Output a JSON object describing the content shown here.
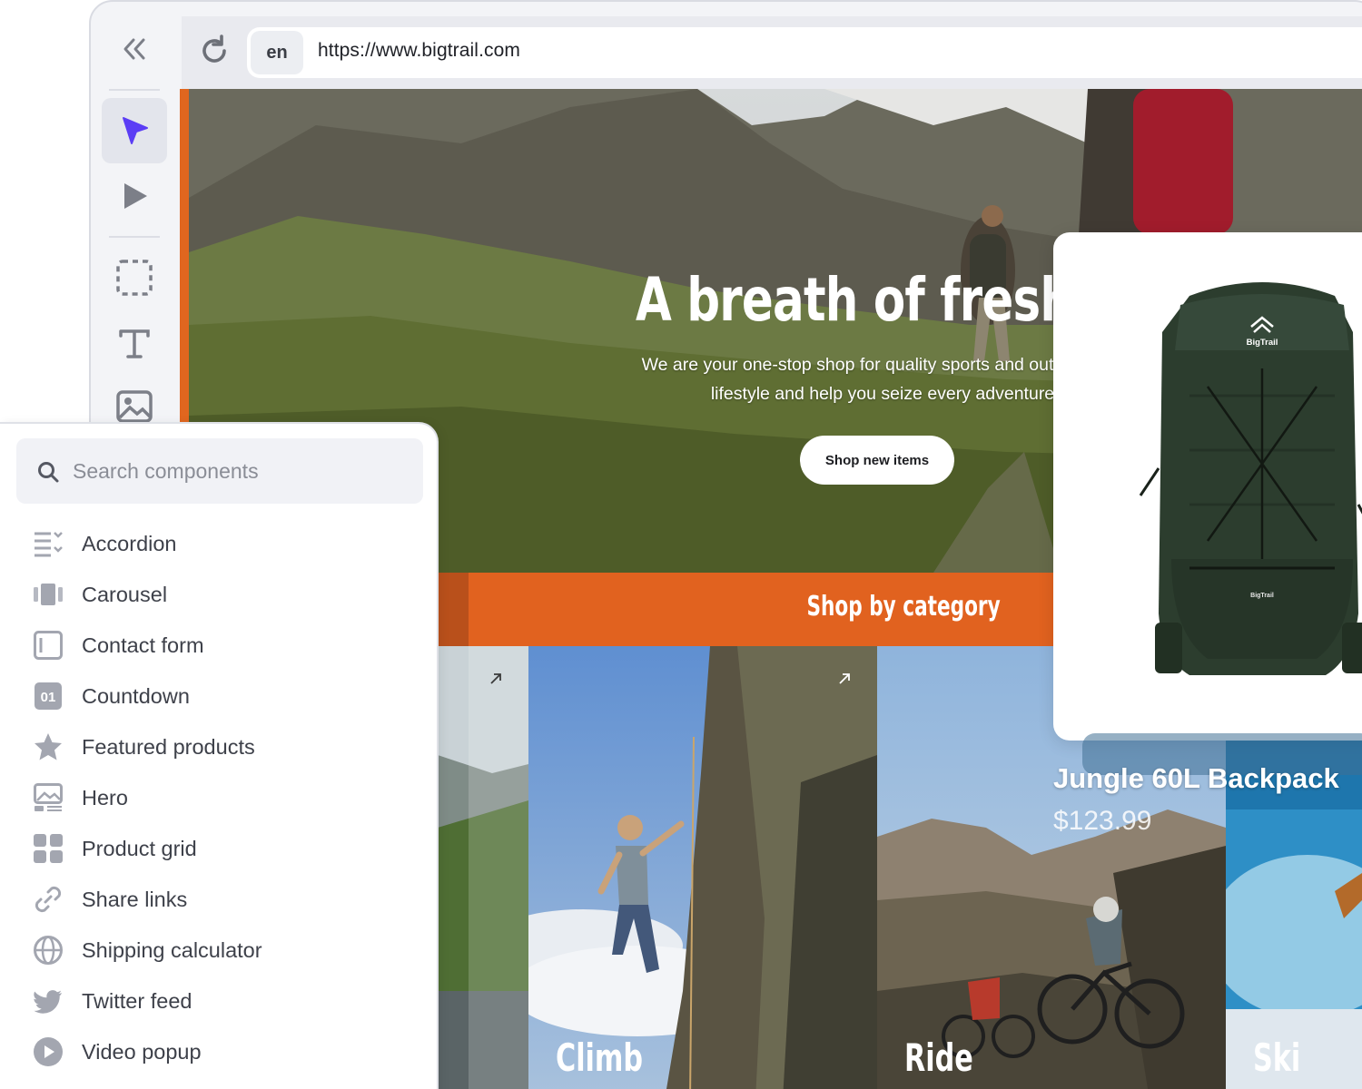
{
  "browser": {
    "lang": "en",
    "url": "https://www.bigtrail.com"
  },
  "toolbar": {
    "tools": [
      {
        "name": "collapse",
        "icon": "double-chevron-left-icon"
      },
      {
        "name": "select",
        "icon": "cursor-arrow-icon",
        "active": true
      },
      {
        "name": "preview",
        "icon": "play-icon"
      },
      {
        "name": "container",
        "icon": "dashed-box-icon"
      },
      {
        "name": "text",
        "icon": "text-icon"
      },
      {
        "name": "image",
        "icon": "image-icon"
      }
    ],
    "accent": "#5b3df5"
  },
  "hero": {
    "title": "A breath of fresh",
    "subtitle_line1": "We are your one-stop shop for quality sports and outdoor gea",
    "subtitle_line2": "lifestyle and help you seize every adventure",
    "button": "Shop new items"
  },
  "category": {
    "title": "Shop by category",
    "band_color": "#e1621f",
    "tiles": [
      "Climb",
      "Ride",
      "Ski"
    ]
  },
  "product": {
    "brand": "BigTrail",
    "name": "Jungle 60L Backpack",
    "price": "$123.99"
  },
  "components_panel": {
    "search_placeholder": "Search components",
    "items": [
      {
        "label": "Accordion",
        "icon": "accordion-icon"
      },
      {
        "label": "Carousel",
        "icon": "carousel-icon"
      },
      {
        "label": "Contact form",
        "icon": "contact-form-icon"
      },
      {
        "label": "Countdown",
        "icon": "countdown-icon"
      },
      {
        "label": "Featured products",
        "icon": "star-icon"
      },
      {
        "label": "Hero",
        "icon": "hero-icon"
      },
      {
        "label": "Product grid",
        "icon": "grid-icon"
      },
      {
        "label": "Share links",
        "icon": "link-icon"
      },
      {
        "label": "Shipping calculator",
        "icon": "globe-icon"
      },
      {
        "label": "Twitter feed",
        "icon": "twitter-icon"
      },
      {
        "label": "Video popup",
        "icon": "play-circle-icon"
      }
    ],
    "countdown_badge": "01"
  }
}
